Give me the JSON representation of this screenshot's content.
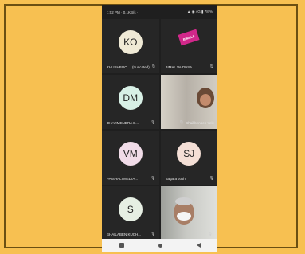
{
  "status_bar": {
    "left": "1:02 PM · 0.1KB/s ·",
    "right": "▲ ◉ 4G ▮ 78 %"
  },
  "participants": [
    {
      "name": "KHUSHBOO ... (truncated)",
      "initials": "KO",
      "avatar_color": "#f0ead6",
      "mic": "muted"
    },
    {
      "name": "BIMAL VAIDHYA ...",
      "initials": "",
      "avatar_color": "#262626",
      "mic": "muted",
      "badge_text": "BIMALE"
    },
    {
      "name": "DHARMENDRA B...",
      "initials": "DM",
      "avatar_color": "#d8f0e6",
      "mic": "muted"
    },
    {
      "name": "Shailibenben Yele",
      "initials": "",
      "avatar_color": "",
      "mic": "muted"
    },
    {
      "name": "VAISHALI MEDIA...",
      "initials": "VM",
      "avatar_color": "#f1dce8",
      "mic": "muted"
    },
    {
      "name": "Sagara Joshi",
      "initials": "SJ",
      "avatar_color": "#f4dfd6",
      "mic": "muted"
    },
    {
      "name": "SHAILABEN KUCH...",
      "initials": "S",
      "avatar_color": "#e6efe3",
      "mic": "muted"
    },
    {
      "name": "",
      "initials": "",
      "avatar_color": "",
      "mic": "muted"
    }
  ],
  "colors": {
    "page_bg": "#f7c051",
    "frame": "#6b4f12",
    "phone_bg": "#1f1f1f",
    "tile_bg": "#262626"
  }
}
